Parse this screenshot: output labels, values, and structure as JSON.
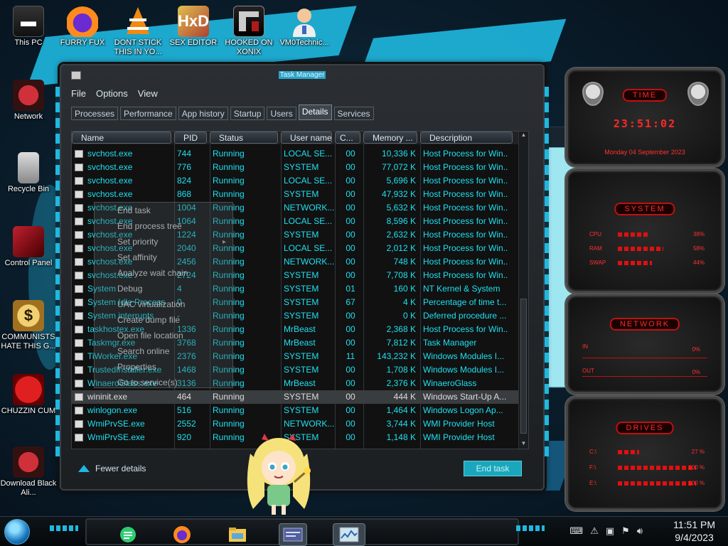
{
  "desktop_icons": [
    {
      "label": "This PC",
      "icon": "computer-icon"
    },
    {
      "label": "FURRY FUX",
      "icon": "firefox-icon"
    },
    {
      "label": "DONT STICK THIS IN YO...",
      "icon": "vlc-icon"
    },
    {
      "label": "SEX EDITOR",
      "icon": "hex-editor-icon"
    },
    {
      "label": "HOOKED ON XONIX",
      "icon": "xonix-game-icon"
    },
    {
      "label": "VM0Technic...",
      "icon": "doctor-icon"
    },
    {
      "label": "Network",
      "icon": "network-icon"
    },
    {
      "label": "Recycle Bin",
      "icon": "recycle-bin-icon"
    },
    {
      "label": "Control Panel",
      "icon": "control-panel-icon"
    },
    {
      "label": "COMMUNISTS HATE THIS G...",
      "icon": "money-bag-icon"
    },
    {
      "label": "CHUZZIN CUM",
      "icon": "chuzzle-icon"
    },
    {
      "label": "Download Black Ali...",
      "icon": "alien-download-icon"
    }
  ],
  "task_manager": {
    "title": "Task Manager",
    "menu": [
      "File",
      "Options",
      "View"
    ],
    "tabs": [
      "Processes",
      "Performance",
      "App history",
      "Startup",
      "Users",
      "Details",
      "Services"
    ],
    "active_tab": "Details",
    "columns": [
      "Name",
      "PID",
      "Status",
      "User name",
      "C...",
      "Memory ...",
      "Description"
    ],
    "rows": [
      [
        "svchost.exe",
        "744",
        "Running",
        "LOCAL SE...",
        "00",
        "10,336 K",
        "Host Process for Win..."
      ],
      [
        "svchost.exe",
        "776",
        "Running",
        "SYSTEM",
        "00",
        "77,072 K",
        "Host Process for Win..."
      ],
      [
        "svchost.exe",
        "824",
        "Running",
        "LOCAL SE...",
        "00",
        "5,696 K",
        "Host Process for Win..."
      ],
      [
        "svchost.exe",
        "868",
        "Running",
        "SYSTEM",
        "00",
        "47,932 K",
        "Host Process for Win..."
      ],
      [
        "svchost.exe",
        "1004",
        "Running",
        "NETWORK...",
        "00",
        "5,632 K",
        "Host Process for Win..."
      ],
      [
        "svchost.exe",
        "1064",
        "Running",
        "LOCAL SE...",
        "00",
        "8,596 K",
        "Host Process for Win..."
      ],
      [
        "svchost.exe",
        "1224",
        "Running",
        "SYSTEM",
        "00",
        "2,632 K",
        "Host Process for Win..."
      ],
      [
        "svchost.exe",
        "2040",
        "Running",
        "LOCAL SE...",
        "00",
        "2,012 K",
        "Host Process for Win..."
      ],
      [
        "svchost.exe",
        "2456",
        "Running",
        "NETWORK...",
        "00",
        "748 K",
        "Host Process for Win..."
      ],
      [
        "svchost.exe",
        "2724",
        "Running",
        "SYSTEM",
        "00",
        "7,708 K",
        "Host Process for Win..."
      ],
      [
        "System",
        "4",
        "Running",
        "SYSTEM",
        "01",
        "160 K",
        "NT Kernel & System"
      ],
      [
        "System Idle Process",
        "0",
        "Running",
        "SYSTEM",
        "67",
        "4 K",
        "Percentage of time t..."
      ],
      [
        "System interrupts",
        "-",
        "Running",
        "SYSTEM",
        "00",
        "0 K",
        "Deferred procedure ..."
      ],
      [
        "taskhostex.exe",
        "1336",
        "Running",
        "MrBeast",
        "00",
        "2,368 K",
        "Host Process for Win..."
      ],
      [
        "Taskmgr.exe",
        "3768",
        "Running",
        "MrBeast",
        "00",
        "7,812 K",
        "Task Manager"
      ],
      [
        "TiWorker.exe",
        "2376",
        "Running",
        "SYSTEM",
        "11",
        "143,232 K",
        "Windows Modules I..."
      ],
      [
        "TrustedInstaller.exe",
        "1468",
        "Running",
        "SYSTEM",
        "00",
        "1,708 K",
        "Windows Modules I..."
      ],
      [
        "WinaeroGlass.exe",
        "3136",
        "Running",
        "MrBeast",
        "00",
        "2,376 K",
        "WinaeroGlass"
      ],
      [
        "wininit.exe",
        "464",
        "Running",
        "SYSTEM",
        "00",
        "444 K",
        "Windows Start-Up A..."
      ],
      [
        "winlogon.exe",
        "516",
        "Running",
        "SYSTEM",
        "00",
        "1,464 K",
        "Windows Logon Ap..."
      ],
      [
        "WmiPrvSE.exe",
        "2552",
        "Running",
        "NETWORK...",
        "00",
        "3,744 K",
        "WMI Provider Host"
      ],
      [
        "WmiPrvSE.exe",
        "920",
        "Running",
        "SYSTEM",
        "00",
        "1,148 K",
        "WMI Provider Host"
      ]
    ],
    "selected_row": 18,
    "context_menu": [
      "End task",
      "End process tree",
      "Set priority",
      "Set affinity",
      "Analyze wait chain",
      "Debug",
      "UAC virtualization",
      "Create dump file",
      "Open file location",
      "Search online",
      "Properties",
      "Go to service(s)"
    ],
    "fewer_details": "Fewer details",
    "end_task": "End task"
  },
  "gadgets": {
    "time_title": "TIME",
    "time": "23:51:02",
    "date": "Monday 04 September 2023",
    "system_title": "SYSTEM",
    "system_rows": [
      {
        "label": "CPU",
        "value": "38%",
        "level": 0.38
      },
      {
        "label": "RAM",
        "value": "58%",
        "level": 0.58
      },
      {
        "label": "SWAP",
        "value": "44%",
        "level": 0.44
      }
    ],
    "network_title": "NETWORK",
    "network_rows": [
      {
        "label": "IN",
        "value": "0%"
      },
      {
        "label": "OUT",
        "value": "0%"
      }
    ],
    "drives_title": "DRIVES",
    "drives": [
      {
        "label": "C:\\",
        "value": "27 %",
        "level": 0.27
      },
      {
        "label": "F:\\",
        "value": "100 %",
        "level": 1.0
      },
      {
        "label": "E:\\",
        "value": "100 %",
        "level": 1.0
      }
    ]
  },
  "taskbar": {
    "apps": [
      "sticky-notes-icon",
      "firefox-icon",
      "file-explorer-icon",
      "window-app-icon",
      "task-manager-icon"
    ],
    "time": "11:51 PM",
    "date": "9/4/2023"
  },
  "colors": {
    "accent": "#1fb8e0",
    "row_text": "#1ee0f0",
    "gadget_red": "#ff2828"
  }
}
